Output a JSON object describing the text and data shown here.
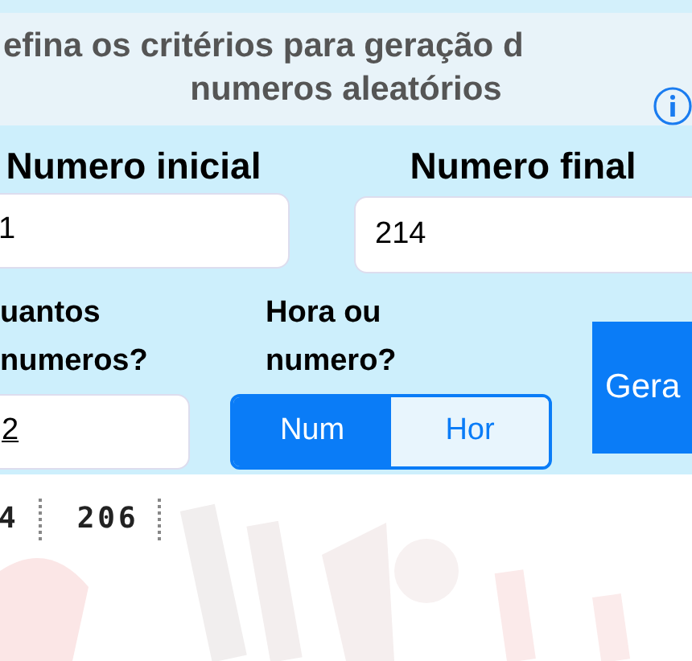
{
  "header": {
    "title": "efina os critérios para geração d",
    "subtitle": "numeros aleatórios"
  },
  "range_fields": [
    {
      "label": "Numero inicial",
      "value": "1"
    },
    {
      "label": "Numero final",
      "value": "214"
    }
  ],
  "count_field": {
    "label": "uantos numeros?",
    "value": "2"
  },
  "mode": {
    "label": "Hora ou numero?",
    "options": [
      {
        "label": "Num",
        "selected": true
      },
      {
        "label": "Hor",
        "selected": false
      }
    ]
  },
  "generate_button": "Gera",
  "results": [
    "4",
    "206"
  ]
}
